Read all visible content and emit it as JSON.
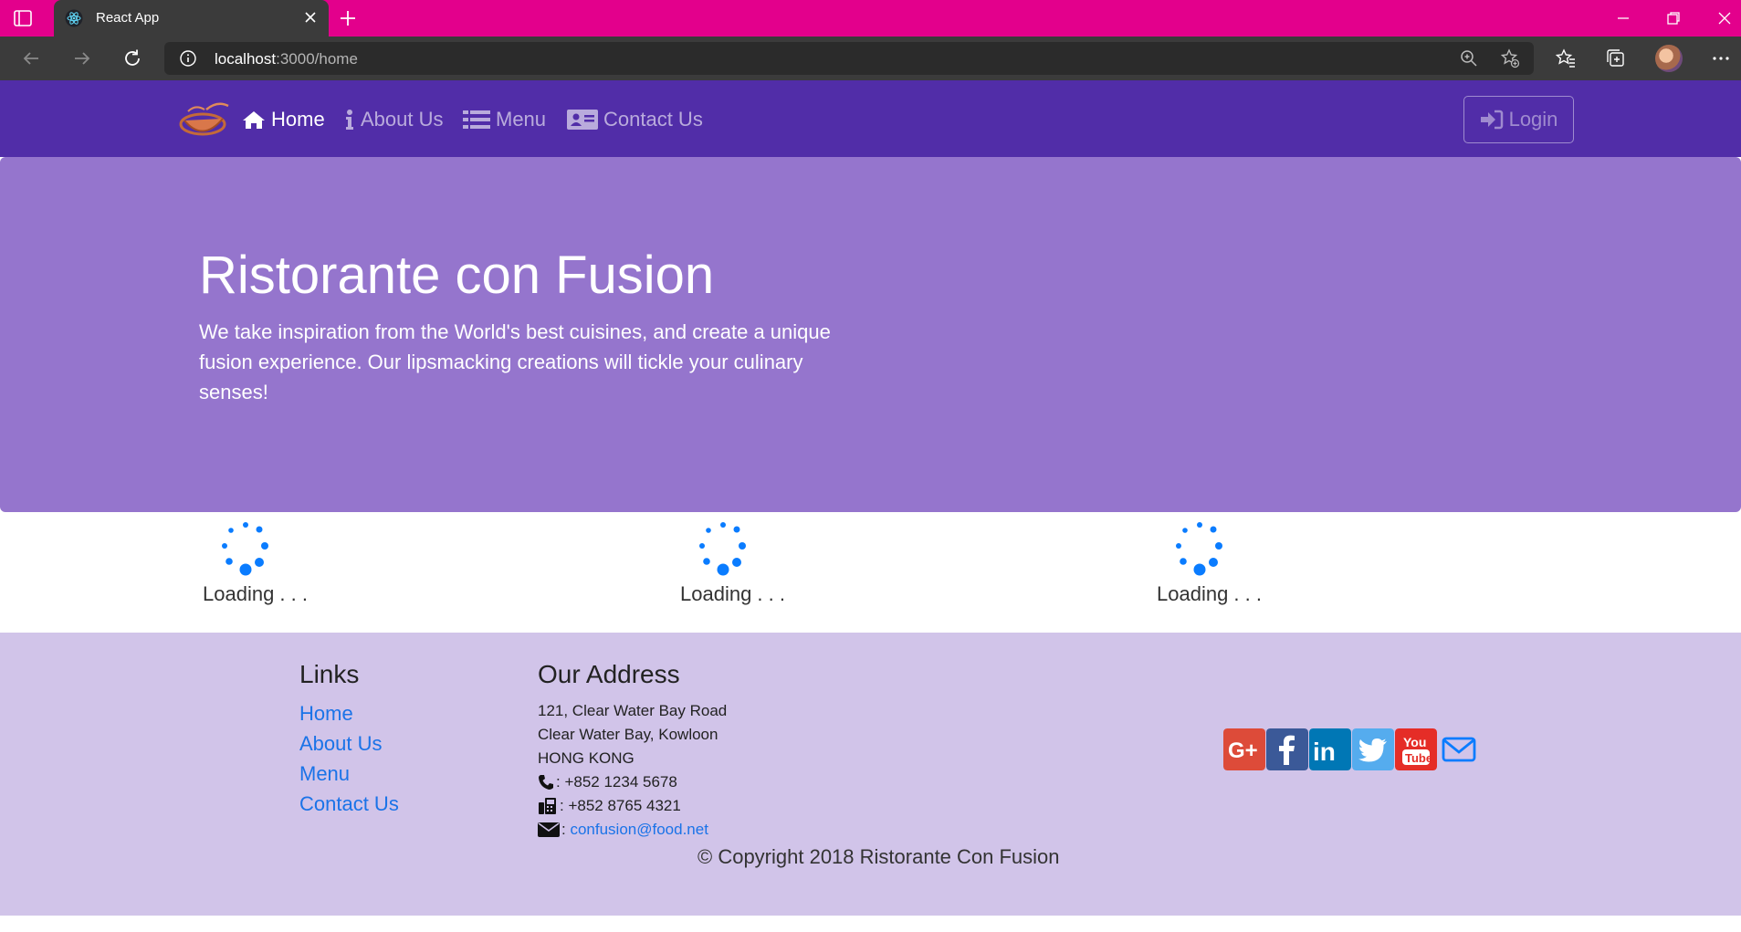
{
  "browser": {
    "tab_title": "React App",
    "url_host": "localhost",
    "url_path": ":3000/home"
  },
  "nav": {
    "home": "Home",
    "about": "About Us",
    "menu": "Menu",
    "contact": "Contact Us",
    "login": "Login"
  },
  "jumbotron": {
    "title": "Ristorante con Fusion",
    "text": "We take inspiration from the World's best cuisines, and create a unique fusion experience. Our lipsmacking creations will tickle your culinary senses!"
  },
  "loaders": [
    {
      "text": "Loading . . ."
    },
    {
      "text": "Loading . . ."
    },
    {
      "text": "Loading . . ."
    }
  ],
  "footer": {
    "links_title": "Links",
    "links": [
      "Home",
      "About Us",
      "Menu",
      "Contact Us"
    ],
    "address_title": "Our Address",
    "address_lines": [
      "121, Clear Water Bay Road",
      "Clear Water Bay, Kowloon",
      "HONG KONG"
    ],
    "phone": ": +852 1234 5678",
    "fax": ": +852 8765 4321",
    "email_prefix": ": ",
    "email": "confusion@food.net",
    "copyright": "© Copyright 2018 Ristorante Con Fusion"
  },
  "colors": {
    "browser_tabbar": "#e3008c",
    "navbar": "#512da8",
    "jumbotron": "#9575cd",
    "footer": "#d1c4e9",
    "spinner": "#0a7cff"
  }
}
